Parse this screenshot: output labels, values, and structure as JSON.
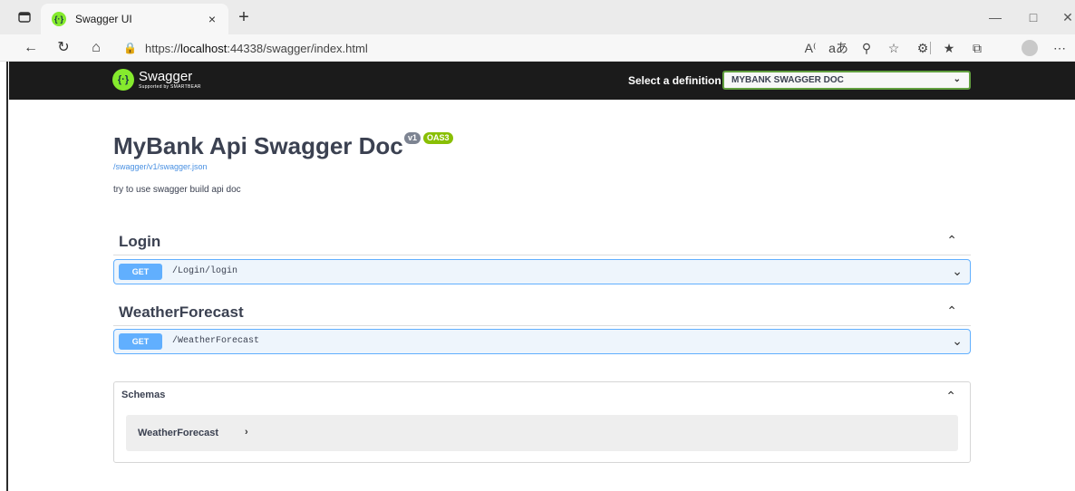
{
  "browser": {
    "tab_title": "Swagger UI",
    "tab_close": "×",
    "new_tab": "+",
    "url_prefix": "https://",
    "url_host": "localhost",
    "url_rest": ":44338/swagger/index.html",
    "icons": [
      "tab-actions-icon",
      "back-icon",
      "refresh-icon",
      "home-icon",
      "lock-icon",
      "read-aloud-icon",
      "translate-icon",
      "zoom-icon",
      "favorite-icon",
      "extensions-icon",
      "favorites-icon",
      "collections-icon",
      "profile-icon",
      "more-icon"
    ]
  },
  "topbar": {
    "brand": "Swagger",
    "sub": "Supported by SMARTBEAR",
    "definition_label": "Select a definition",
    "definition_value": "MYBANK SWAGGER DOC"
  },
  "info": {
    "title": "MyBank Api Swagger Doc",
    "version_badge": "v1",
    "oas_badge": "OAS3",
    "spec_link": "/swagger/v1/swagger.json",
    "description": "try to use swagger build api doc"
  },
  "tags": [
    {
      "name": "Login",
      "operations": [
        {
          "method": "GET",
          "path": "/Login/login"
        }
      ]
    },
    {
      "name": "WeatherForecast",
      "operations": [
        {
          "method": "GET",
          "path": "/WeatherForecast"
        }
      ]
    }
  ],
  "schemas": {
    "title": "Schemas",
    "models": [
      {
        "name": "WeatherForecast"
      }
    ]
  },
  "colors": {
    "get": "#61affe",
    "get_bg": "#eef5fc",
    "swagger_green": "#85ea2d",
    "topbar": "#1b1b1b",
    "text": "#3b4151"
  }
}
